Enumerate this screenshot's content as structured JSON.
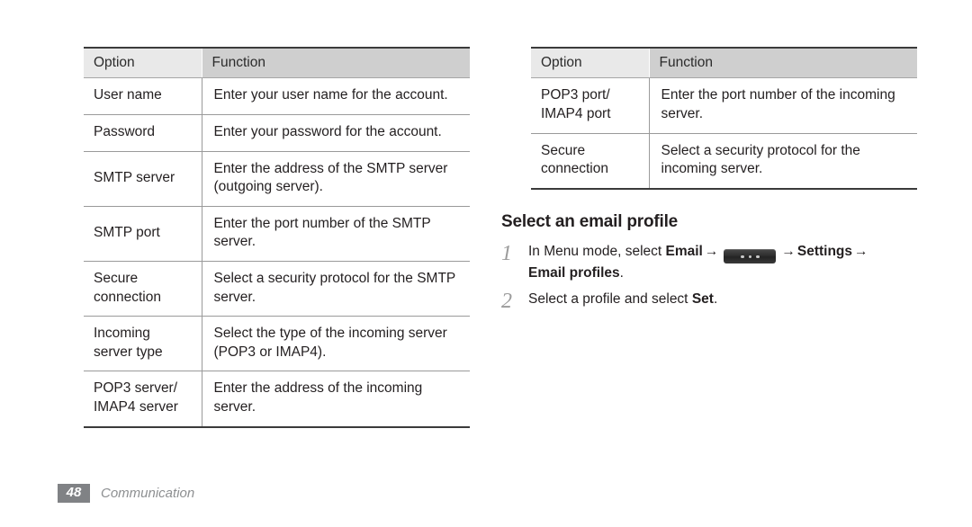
{
  "document": {
    "left_table": {
      "headers": [
        "Option",
        "Function"
      ],
      "rows": [
        {
          "option": "User name",
          "function": "Enter your user name for the account."
        },
        {
          "option": "Password",
          "function": "Enter your password for the account."
        },
        {
          "option": "SMTP server",
          "function": "Enter the address of the SMTP server (outgoing server)."
        },
        {
          "option": "SMTP port",
          "function": "Enter the port number of the SMTP server."
        },
        {
          "option": "Secure connection",
          "function": "Select a security protocol for the SMTP server."
        },
        {
          "option": "Incoming server type",
          "function": "Select the type of the incoming server (POP3 or IMAP4)."
        },
        {
          "option": "POP3 server/ IMAP4 server",
          "function": "Enter the address of the incoming server."
        }
      ]
    },
    "right_table": {
      "headers": [
        "Option",
        "Function"
      ],
      "rows": [
        {
          "option": "POP3 port/ IMAP4 port",
          "function": "Enter the port number of the incoming server."
        },
        {
          "option": "Secure connection",
          "function": "Select a security protocol for the incoming server."
        }
      ]
    },
    "section": {
      "heading": "Select an email profile",
      "steps": [
        {
          "number": "1",
          "pre": "In Menu mode, select ",
          "bold1": "Email",
          "arrow1": "→",
          "key_icon": "menu-key-icon",
          "arrow2": "→",
          "bold2": "Settings",
          "arrow3": "→",
          "bold3": "Email profiles",
          "post": "."
        },
        {
          "number": "2",
          "pre": "Select a profile and select ",
          "bold1": "Set",
          "post": "."
        }
      ]
    },
    "footer": {
      "page_number": "48",
      "chapter": "Communication"
    },
    "colors": {
      "text": "#231f20",
      "header_option_bg": "#e9e9e9",
      "header_function_bg": "#cfcfcf",
      "rule": "#9a9a9a",
      "outer_rule": "#3b3b3b",
      "footer_badge_bg": "#808285",
      "footer_label": "#8d8f91",
      "step_number": "#9b9b9b"
    }
  }
}
